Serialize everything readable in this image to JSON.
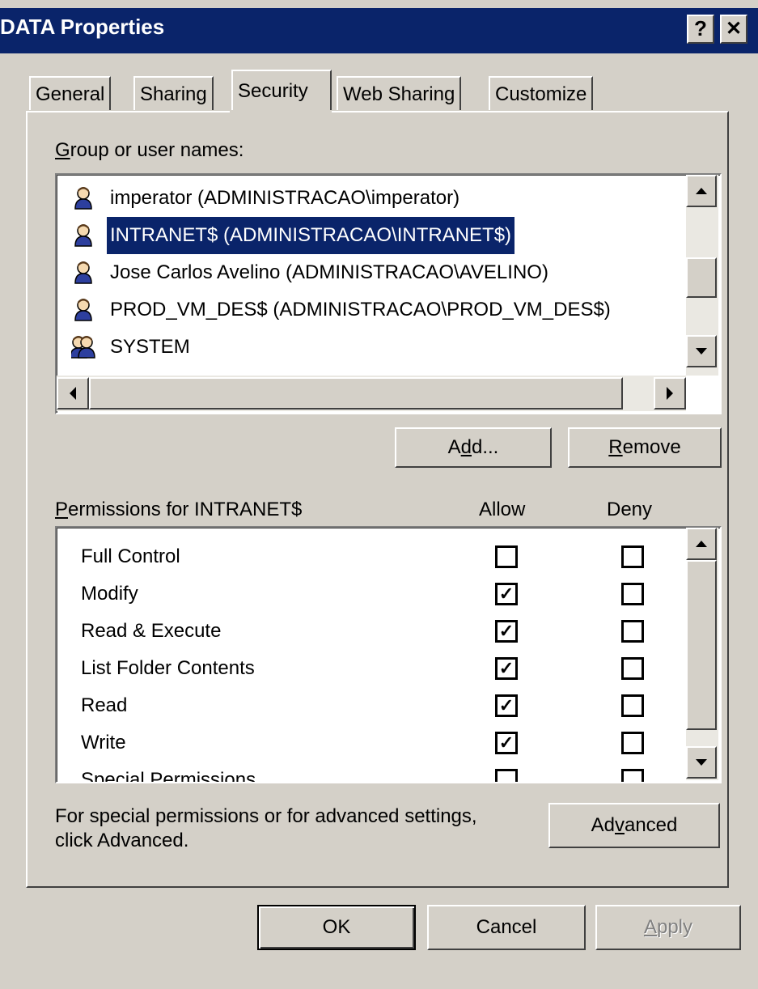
{
  "window": {
    "title": "DATA Properties",
    "help_label": "?",
    "close_label": "✕"
  },
  "tabs": [
    {
      "label": "General",
      "active": false
    },
    {
      "label": "Sharing",
      "active": false
    },
    {
      "label": "Security",
      "active": true
    },
    {
      "label": "Web Sharing",
      "active": false
    },
    {
      "label": "Customize",
      "active": false
    }
  ],
  "group_label": {
    "accel": "G",
    "rest": "roup or user names:"
  },
  "users": [
    {
      "name": "imperator (ADMINISTRACAO\\imperator)",
      "icon": "user-icon",
      "selected": false
    },
    {
      "name": "INTRANET$ (ADMINISTRACAO\\INTRANET$)",
      "icon": "user-icon",
      "selected": true
    },
    {
      "name": "Jose Carlos Avelino (ADMINISTRACAO\\AVELINO)",
      "icon": "user-icon",
      "selected": false
    },
    {
      "name": "PROD_VM_DES$ (ADMINISTRACAO\\PROD_VM_DES$)",
      "icon": "user-icon",
      "selected": false
    },
    {
      "name": "SYSTEM",
      "icon": "group-icon",
      "selected": false
    }
  ],
  "buttons": {
    "add": {
      "pre": "A",
      "accel": "d",
      "post": "d..."
    },
    "remove": {
      "accel": "R",
      "post": "emove"
    },
    "advanced": {
      "pre": "Ad",
      "accel": "v",
      "post": "anced"
    },
    "ok": "OK",
    "cancel": "Cancel",
    "apply": {
      "accel": "A",
      "post": "pply"
    }
  },
  "permissions": {
    "title": {
      "accel": "P",
      "rest": "ermissions for INTRANET$"
    },
    "allow_header": "Allow",
    "deny_header": "Deny",
    "rows": [
      {
        "label": "Full Control",
        "allow": false,
        "deny": false
      },
      {
        "label": "Modify",
        "allow": true,
        "deny": false
      },
      {
        "label": "Read & Execute",
        "allow": true,
        "deny": false
      },
      {
        "label": "List Folder Contents",
        "allow": true,
        "deny": false
      },
      {
        "label": "Read",
        "allow": true,
        "deny": false
      },
      {
        "label": "Write",
        "allow": true,
        "deny": false
      },
      {
        "label": "Special Permissions",
        "allow": false,
        "deny": false
      }
    ]
  },
  "advanced_note": {
    "line1": "For special permissions or for advanced settings,",
    "line2": "click Advanced."
  },
  "colors": {
    "titlebar": "#0a246a",
    "face": "#d4d0c8",
    "selection": "#0a246a"
  }
}
